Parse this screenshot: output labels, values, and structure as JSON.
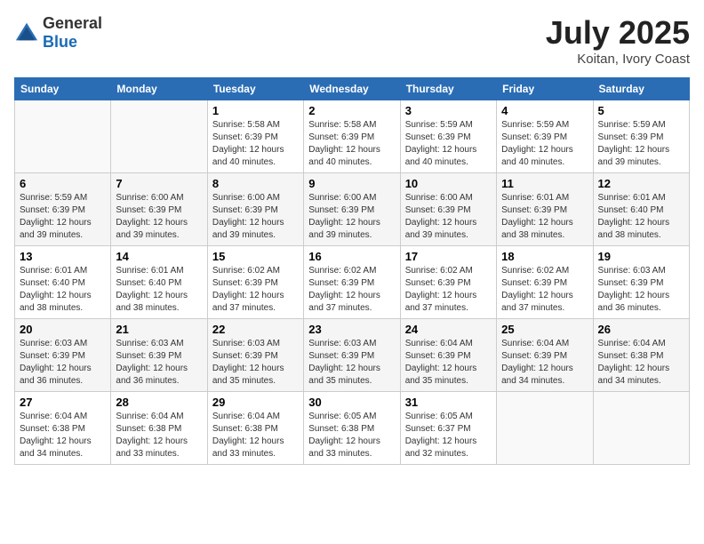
{
  "logo": {
    "text_general": "General",
    "text_blue": "Blue"
  },
  "title": "July 2025",
  "subtitle": "Koitan, Ivory Coast",
  "weekdays": [
    "Sunday",
    "Monday",
    "Tuesday",
    "Wednesday",
    "Thursday",
    "Friday",
    "Saturday"
  ],
  "weeks": [
    [
      {
        "day": "",
        "info": ""
      },
      {
        "day": "",
        "info": ""
      },
      {
        "day": "1",
        "info": "Sunrise: 5:58 AM\nSunset: 6:39 PM\nDaylight: 12 hours\nand 40 minutes."
      },
      {
        "day": "2",
        "info": "Sunrise: 5:58 AM\nSunset: 6:39 PM\nDaylight: 12 hours\nand 40 minutes."
      },
      {
        "day": "3",
        "info": "Sunrise: 5:59 AM\nSunset: 6:39 PM\nDaylight: 12 hours\nand 40 minutes."
      },
      {
        "day": "4",
        "info": "Sunrise: 5:59 AM\nSunset: 6:39 PM\nDaylight: 12 hours\nand 40 minutes."
      },
      {
        "day": "5",
        "info": "Sunrise: 5:59 AM\nSunset: 6:39 PM\nDaylight: 12 hours\nand 39 minutes."
      }
    ],
    [
      {
        "day": "6",
        "info": "Sunrise: 5:59 AM\nSunset: 6:39 PM\nDaylight: 12 hours\nand 39 minutes."
      },
      {
        "day": "7",
        "info": "Sunrise: 6:00 AM\nSunset: 6:39 PM\nDaylight: 12 hours\nand 39 minutes."
      },
      {
        "day": "8",
        "info": "Sunrise: 6:00 AM\nSunset: 6:39 PM\nDaylight: 12 hours\nand 39 minutes."
      },
      {
        "day": "9",
        "info": "Sunrise: 6:00 AM\nSunset: 6:39 PM\nDaylight: 12 hours\nand 39 minutes."
      },
      {
        "day": "10",
        "info": "Sunrise: 6:00 AM\nSunset: 6:39 PM\nDaylight: 12 hours\nand 39 minutes."
      },
      {
        "day": "11",
        "info": "Sunrise: 6:01 AM\nSunset: 6:39 PM\nDaylight: 12 hours\nand 38 minutes."
      },
      {
        "day": "12",
        "info": "Sunrise: 6:01 AM\nSunset: 6:40 PM\nDaylight: 12 hours\nand 38 minutes."
      }
    ],
    [
      {
        "day": "13",
        "info": "Sunrise: 6:01 AM\nSunset: 6:40 PM\nDaylight: 12 hours\nand 38 minutes."
      },
      {
        "day": "14",
        "info": "Sunrise: 6:01 AM\nSunset: 6:40 PM\nDaylight: 12 hours\nand 38 minutes."
      },
      {
        "day": "15",
        "info": "Sunrise: 6:02 AM\nSunset: 6:39 PM\nDaylight: 12 hours\nand 37 minutes."
      },
      {
        "day": "16",
        "info": "Sunrise: 6:02 AM\nSunset: 6:39 PM\nDaylight: 12 hours\nand 37 minutes."
      },
      {
        "day": "17",
        "info": "Sunrise: 6:02 AM\nSunset: 6:39 PM\nDaylight: 12 hours\nand 37 minutes."
      },
      {
        "day": "18",
        "info": "Sunrise: 6:02 AM\nSunset: 6:39 PM\nDaylight: 12 hours\nand 37 minutes."
      },
      {
        "day": "19",
        "info": "Sunrise: 6:03 AM\nSunset: 6:39 PM\nDaylight: 12 hours\nand 36 minutes."
      }
    ],
    [
      {
        "day": "20",
        "info": "Sunrise: 6:03 AM\nSunset: 6:39 PM\nDaylight: 12 hours\nand 36 minutes."
      },
      {
        "day": "21",
        "info": "Sunrise: 6:03 AM\nSunset: 6:39 PM\nDaylight: 12 hours\nand 36 minutes."
      },
      {
        "day": "22",
        "info": "Sunrise: 6:03 AM\nSunset: 6:39 PM\nDaylight: 12 hours\nand 35 minutes."
      },
      {
        "day": "23",
        "info": "Sunrise: 6:03 AM\nSunset: 6:39 PM\nDaylight: 12 hours\nand 35 minutes."
      },
      {
        "day": "24",
        "info": "Sunrise: 6:04 AM\nSunset: 6:39 PM\nDaylight: 12 hours\nand 35 minutes."
      },
      {
        "day": "25",
        "info": "Sunrise: 6:04 AM\nSunset: 6:39 PM\nDaylight: 12 hours\nand 34 minutes."
      },
      {
        "day": "26",
        "info": "Sunrise: 6:04 AM\nSunset: 6:38 PM\nDaylight: 12 hours\nand 34 minutes."
      }
    ],
    [
      {
        "day": "27",
        "info": "Sunrise: 6:04 AM\nSunset: 6:38 PM\nDaylight: 12 hours\nand 34 minutes."
      },
      {
        "day": "28",
        "info": "Sunrise: 6:04 AM\nSunset: 6:38 PM\nDaylight: 12 hours\nand 33 minutes."
      },
      {
        "day": "29",
        "info": "Sunrise: 6:04 AM\nSunset: 6:38 PM\nDaylight: 12 hours\nand 33 minutes."
      },
      {
        "day": "30",
        "info": "Sunrise: 6:05 AM\nSunset: 6:38 PM\nDaylight: 12 hours\nand 33 minutes."
      },
      {
        "day": "31",
        "info": "Sunrise: 6:05 AM\nSunset: 6:37 PM\nDaylight: 12 hours\nand 32 minutes."
      },
      {
        "day": "",
        "info": ""
      },
      {
        "day": "",
        "info": ""
      }
    ]
  ]
}
